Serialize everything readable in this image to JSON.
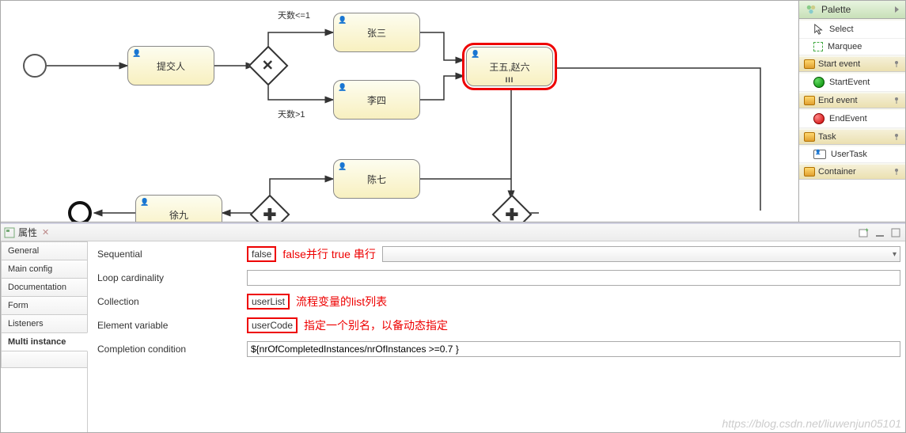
{
  "palette": {
    "title": "Palette",
    "tools": {
      "select": "Select",
      "marquee": "Marquee"
    },
    "groups": {
      "start": {
        "label": "Start event",
        "items": {
          "startevent": "StartEvent"
        }
      },
      "end": {
        "label": "End event",
        "items": {
          "endevent": "EndEvent"
        }
      },
      "task": {
        "label": "Task",
        "items": {
          "usertask": "UserTask"
        }
      },
      "container": {
        "label": "Container"
      }
    }
  },
  "diagram": {
    "tasks": {
      "submit": "提交人",
      "zhangsan": "张三",
      "lisi": "李四",
      "wangwu_zhaoliu": "王五,赵六",
      "chenqi": "陈七",
      "xujiu": "徐九"
    },
    "labels": {
      "days_le1": "天数<=1",
      "days_gt1": "天数>1"
    }
  },
  "props": {
    "panel_title": "属性",
    "tabs": {
      "general": "General",
      "main_config": "Main config",
      "documentation": "Documentation",
      "form": "Form",
      "listeners": "Listeners",
      "multi_instance": "Multi instance"
    },
    "fields": {
      "sequential": {
        "label": "Sequential",
        "value": "false"
      },
      "loop_cardinality": {
        "label": "Loop cardinality",
        "value": ""
      },
      "collection": {
        "label": "Collection",
        "value": "userList"
      },
      "element_variable": {
        "label": "Element variable",
        "value": "userCode"
      },
      "completion_condition": {
        "label": "Completion condition",
        "value": "${nrOfCompletedInstances/nrOfInstances >=0.7 }"
      }
    },
    "annotations": {
      "sequential": "false并行 true 串行",
      "collection": "流程变量的list列表",
      "element_variable": "指定一个别名，以备动态指定"
    }
  },
  "watermark": "https://blog.csdn.net/liuwenjun05101"
}
